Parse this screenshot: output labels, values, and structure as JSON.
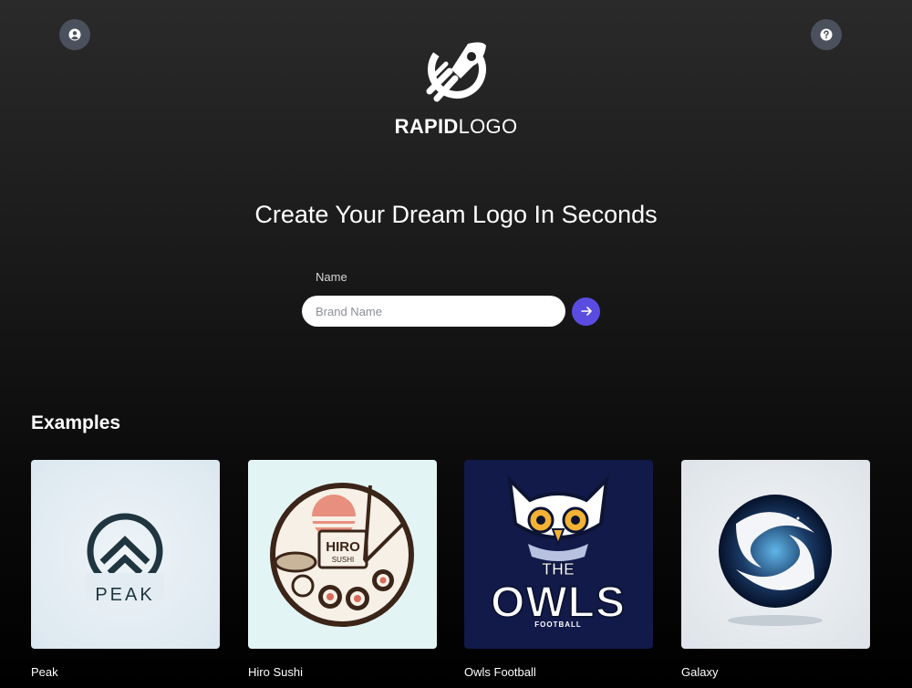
{
  "header": {
    "brand_bold": "RAPID",
    "brand_light": "LOGO",
    "account_icon": "user-circle-icon",
    "help_icon": "question-icon"
  },
  "hero": {
    "headline": "Create Your Dream Logo In Seconds",
    "name_label": "Name",
    "name_placeholder": "Brand Name",
    "name_value": "",
    "submit_icon": "arrow-right-icon"
  },
  "examples": {
    "title": "Examples",
    "items": [
      {
        "label": "Peak",
        "logo_text": "PEAK"
      },
      {
        "label": "Hiro Sushi",
        "logo_text_1": "HIRO",
        "logo_text_2": "SUSHI"
      },
      {
        "label": "Owls Football",
        "logo_text_1": "THE",
        "logo_text_2": "OWLS",
        "logo_text_3": "FOOTBALL"
      },
      {
        "label": "Galaxy"
      }
    ]
  },
  "colors": {
    "accent": "#5a4ce0",
    "corner_button": "#4a505c"
  }
}
